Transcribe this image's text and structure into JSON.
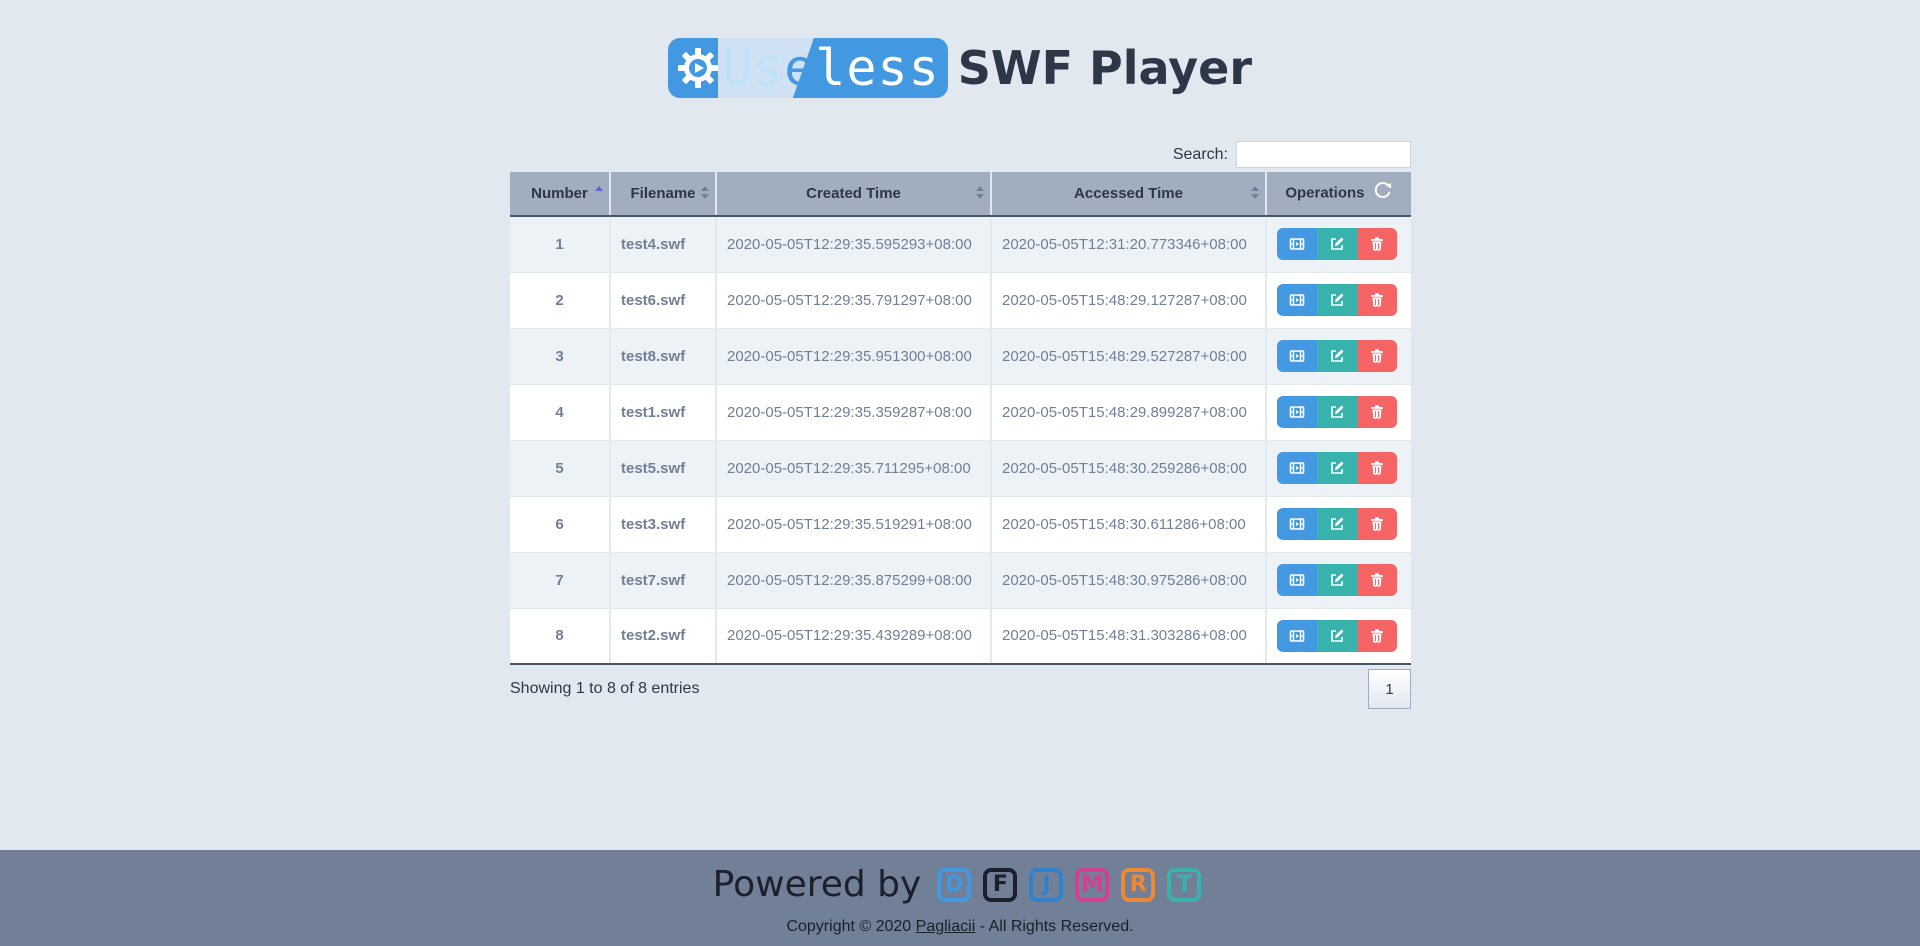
{
  "header": {
    "logo_text_start": "Us",
    "logo_text_shaded": "e",
    "logo_text_end": "less",
    "title": "SWF Player"
  },
  "search": {
    "label": "Search:",
    "value": "",
    "placeholder": ""
  },
  "table": {
    "columns": [
      "Number",
      "Filename",
      "Created Time",
      "Accessed Time",
      "Operations"
    ],
    "rows": [
      {
        "number": "1",
        "filename": "test4.swf",
        "created": "2020-05-05T12:29:35.595293+08:00",
        "accessed": "2020-05-05T12:31:20.773346+08:00"
      },
      {
        "number": "2",
        "filename": "test6.swf",
        "created": "2020-05-05T12:29:35.791297+08:00",
        "accessed": "2020-05-05T15:48:29.127287+08:00"
      },
      {
        "number": "3",
        "filename": "test8.swf",
        "created": "2020-05-05T12:29:35.951300+08:00",
        "accessed": "2020-05-05T15:48:29.527287+08:00"
      },
      {
        "number": "4",
        "filename": "test1.swf",
        "created": "2020-05-05T12:29:35.359287+08:00",
        "accessed": "2020-05-05T15:48:29.899287+08:00"
      },
      {
        "number": "5",
        "filename": "test5.swf",
        "created": "2020-05-05T12:29:35.711295+08:00",
        "accessed": "2020-05-05T15:48:30.259286+08:00"
      },
      {
        "number": "6",
        "filename": "test3.swf",
        "created": "2020-05-05T12:29:35.519291+08:00",
        "accessed": "2020-05-05T15:48:30.611286+08:00"
      },
      {
        "number": "7",
        "filename": "test7.swf",
        "created": "2020-05-05T12:29:35.875299+08:00",
        "accessed": "2020-05-05T15:48:30.975286+08:00"
      },
      {
        "number": "8",
        "filename": "test2.swf",
        "created": "2020-05-05T12:29:35.439289+08:00",
        "accessed": "2020-05-05T15:48:31.303286+08:00"
      }
    ]
  },
  "pagination": {
    "info": "Showing 1 to 8 of 8 entries",
    "current_page": "1"
  },
  "footer": {
    "powered_by": "Powered by",
    "badges": [
      {
        "letter": "D",
        "color": "#4299e1"
      },
      {
        "letter": "F",
        "color": "#1a202c"
      },
      {
        "letter": "J",
        "color": "#3182ce"
      },
      {
        "letter": "M",
        "color": "#d53f8c"
      },
      {
        "letter": "R",
        "color": "#ed8936"
      },
      {
        "letter": "T",
        "color": "#38b2ac"
      }
    ],
    "copyright_prefix": "Copyright © 2020",
    "author_link": "Pagliacii",
    "copyright_suffix": "- All Rights Reserved."
  },
  "colors": {
    "play": "#4299e1",
    "edit": "#38b2ac",
    "delete": "#f56565",
    "header_bg": "#a0aec0",
    "page_bg": "#e2e8f0",
    "footer_bg": "#718096"
  }
}
